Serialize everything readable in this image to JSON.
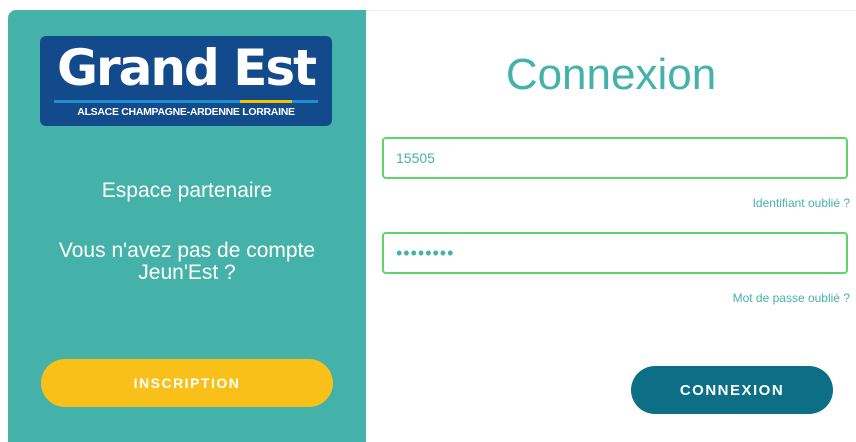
{
  "logo": {
    "name": "Grand Est",
    "tagline": "ALSACE CHAMPAGNE-ARDENNE LORRAINE"
  },
  "left_panel": {
    "heading": "Espace partenaire",
    "no_account_text": "Vous n'avez pas de compte Jeun'Est ?",
    "inscription_label": "INSCRIPTION"
  },
  "login": {
    "title": "Connexion",
    "identifier_value": "15505",
    "forgot_identifier": "Identifiant oublié ?",
    "password_value": "••••••••",
    "forgot_password": "Mot de passe oublié ?",
    "submit_label": "CONNEXION"
  },
  "colors": {
    "teal_panel": "#45b2aa",
    "inscription_button": "#f9c019",
    "connexion_button": "#0c6f86",
    "field_border": "#5cd66c",
    "logo_blue": "#134a8c"
  }
}
